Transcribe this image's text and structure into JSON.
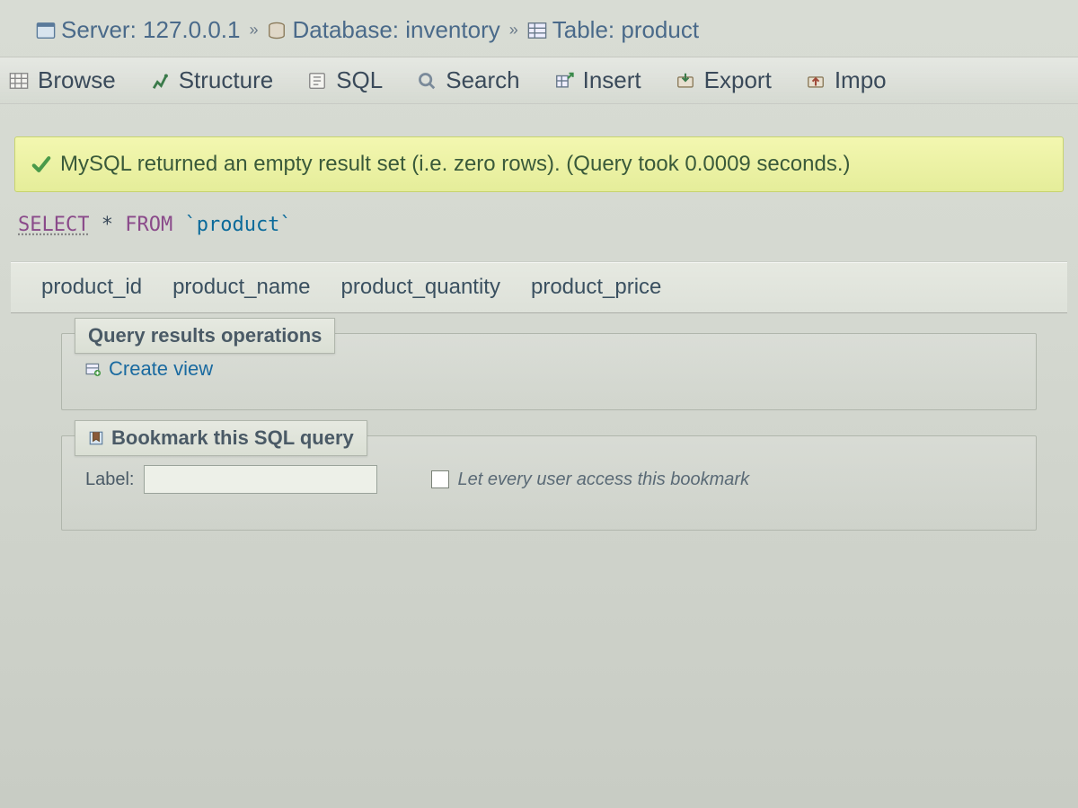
{
  "breadcrumb": {
    "server_label": "Server: 127.0.0.1",
    "database_label": "Database: inventory",
    "table_label": "Table: product"
  },
  "tabs": {
    "browse": "Browse",
    "structure": "Structure",
    "sql": "SQL",
    "search": "Search",
    "insert": "Insert",
    "export": "Export",
    "import": "Impo"
  },
  "notice": {
    "text": "MySQL returned an empty result set (i.e. zero rows). (Query took 0.0009 seconds.)"
  },
  "sql": {
    "select_kw": "SELECT",
    "star": "*",
    "from_kw": "FROM",
    "table_ident": "`product`"
  },
  "columns": [
    "product_id",
    "product_name",
    "product_quantity",
    "product_price"
  ],
  "operations": {
    "legend": "Query results operations",
    "create_view": "Create view"
  },
  "bookmark": {
    "legend": "Bookmark this SQL query",
    "label_text": "Label:",
    "input_value": "",
    "checkbox_label": "Let every user access this bookmark"
  }
}
